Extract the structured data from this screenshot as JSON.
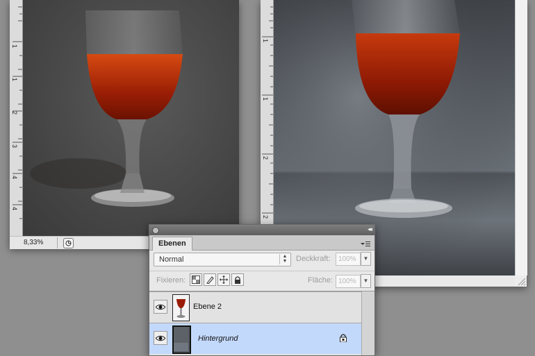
{
  "left_doc": {
    "ruler_labels": [
      "1",
      "1",
      "1",
      "2",
      "2",
      "3",
      "3",
      "4",
      "4"
    ],
    "zoom": "8,33%"
  },
  "right_doc": {
    "ruler_labels": [
      "1",
      "0",
      "1",
      "5",
      "2",
      "0",
      "2",
      "5"
    ]
  },
  "layers_panel": {
    "tab_label": "Ebenen",
    "blend_mode": "Normal",
    "opacity_label": "Deckkraft:",
    "opacity_value": "100%",
    "lock_label": "Fixieren:",
    "fill_label": "Fläche:",
    "fill_value": "100%",
    "layers": [
      {
        "name": "Ebene 2",
        "visible": true,
        "selected": false
      },
      {
        "name": "Hintergrund",
        "visible": true,
        "selected": true,
        "locked": true
      }
    ]
  },
  "colors": {
    "selection": "#c3d9fb",
    "panel_bg": "#e8e8e8",
    "workspace": "#8f8f8f"
  }
}
